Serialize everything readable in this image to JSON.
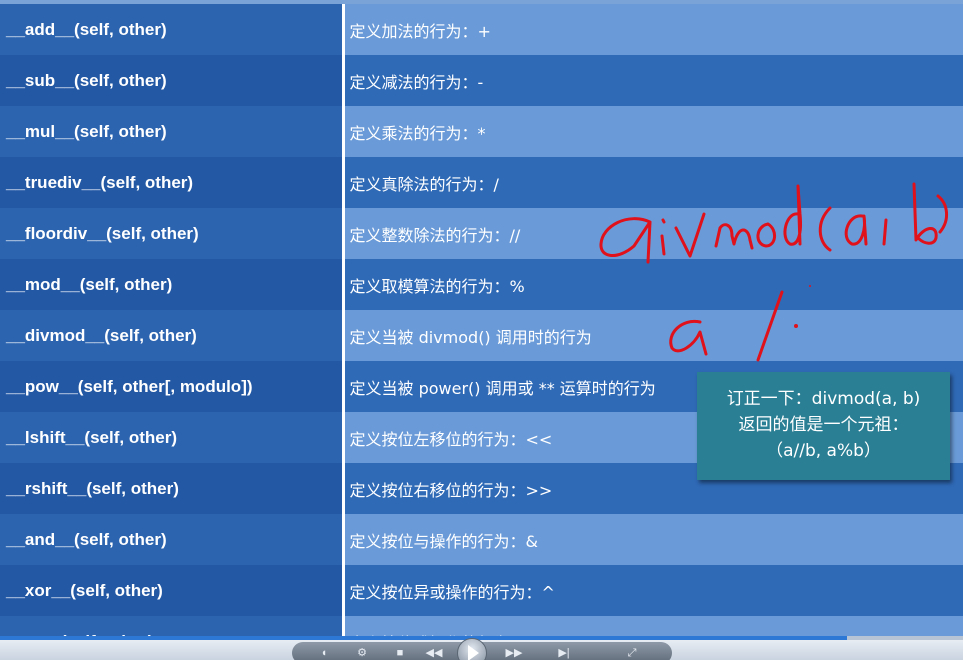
{
  "table": {
    "rows": [
      {
        "name": "__add__(self, other)",
        "desc": "定义加法的行为：+"
      },
      {
        "name": "__sub__(self, other)",
        "desc": "定义减法的行为：-"
      },
      {
        "name": "__mul__(self, other)",
        "desc": "定义乘法的行为：*"
      },
      {
        "name": "__truediv__(self, other)",
        "desc": "定义真除法的行为：/"
      },
      {
        "name": "__floordiv__(self, other)",
        "desc": "定义整数除法的行为：//"
      },
      {
        "name": "__mod__(self, other)",
        "desc": "定义取模算法的行为：%"
      },
      {
        "name": "__divmod__(self, other)",
        "desc": "定义当被 divmod() 调用时的行为"
      },
      {
        "name": "__pow__(self, other[, modulo])",
        "desc": "定义当被 power() 调用或 ** 运算时的行为"
      },
      {
        "name": "__lshift__(self, other)",
        "desc": "定义按位左移位的行为：<<"
      },
      {
        "name": "__rshift__(self, other)",
        "desc": "定义按位右移位的行为：>>"
      },
      {
        "name": "__and__(self, other)",
        "desc": "定义按位与操作的行为：&"
      },
      {
        "name": "__xor__(self, other)",
        "desc": "定义按位异或操作的行为：^"
      },
      {
        "name": "__or__(self, other)",
        "desc": "定义按位或操作的行为：|"
      }
    ]
  },
  "annotation": {
    "handwriting": "divmod(a, b)",
    "handwriting_2": "a /",
    "ink_color": "#e0111a"
  },
  "tooltip": {
    "line1": "订正一下：divmod(a, b)",
    "line2": "返回的值是一个元祖：",
    "line3": "（a//b, a%b）"
  },
  "player": {
    "progress": 0.88,
    "accent": "#2c78d4"
  }
}
